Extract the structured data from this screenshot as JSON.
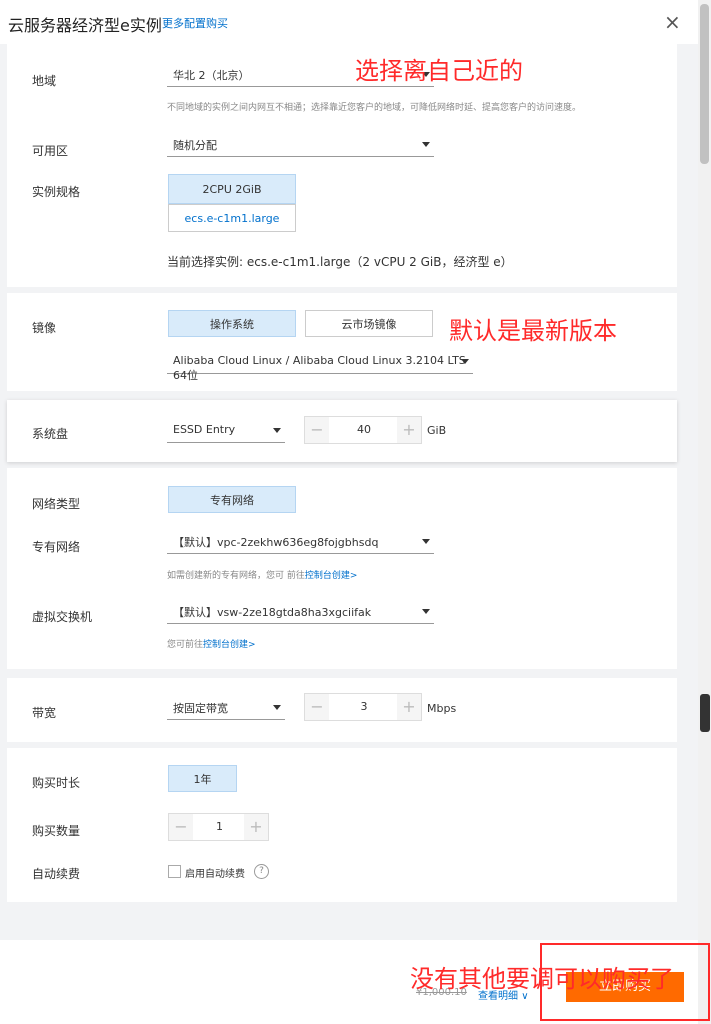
{
  "header": {
    "title": "云服务器经济型e实例",
    "more_link": "更多配置购买",
    "close": "×"
  },
  "region": {
    "label": "地域",
    "value": "华北 2（北京）",
    "hint": "不同地域的实例之间内网互不相通；选择靠近您客户的地域，可降低网络时延、提高您客户的访问速度。"
  },
  "zone": {
    "label": "可用区",
    "value": "随机分配"
  },
  "spec": {
    "label": "实例规格",
    "option_top": "2CPU 2GiB",
    "option_bottom": "ecs.e-c1m1.large",
    "current": "当前选择实例: ecs.e-c1m1.large（2 vCPU 2 GiB，经济型 e）"
  },
  "image": {
    "label": "镜像",
    "tab_os": "操作系统",
    "tab_market": "云市场镜像",
    "os_value": "Alibaba Cloud Linux / Alibaba Cloud Linux 3.2104 LTS 64位"
  },
  "disk": {
    "label": "系统盘",
    "type": "ESSD Entry",
    "size": "40",
    "unit": "GiB"
  },
  "network": {
    "type_label": "网络类型",
    "type_value": "专有网络",
    "vpc_label": "专有网络",
    "vpc_value": "【默认】vpc-2zekhw636eg8fojgbhsdq",
    "vpc_hint": "如需创建新的专有网络，您可 前往",
    "vpc_hint_link": "控制台创建>",
    "vsw_label": "虚拟交换机",
    "vsw_value": "【默认】vsw-2ze18gtda8ha3xgciifak",
    "vsw_hint": "您可前往",
    "vsw_hint_link": "控制台创建>"
  },
  "bandwidth": {
    "label": "带宽",
    "type": "按固定带宽",
    "value": "3",
    "unit": "Mbps"
  },
  "purchase": {
    "duration_label": "购买时长",
    "duration_value": "1年",
    "count_label": "购买数量",
    "count_value": "1",
    "renew_label": "自动续费",
    "renew_checkbox": "启用自动续费",
    "help": "?"
  },
  "footer": {
    "price_strike": "¥1,000.10",
    "detail_link": "查看明细",
    "buy_button": "立即购买"
  },
  "annotations": {
    "a1": "选择离自己近的",
    "a2": "默认是最新版本",
    "a3": "没有其他要调可以购买了"
  },
  "colors": {
    "accent": "#0070cc",
    "selected_bg": "#d9ebfa",
    "annotation": "#ff2a2a",
    "buy": "#ff6a00"
  }
}
